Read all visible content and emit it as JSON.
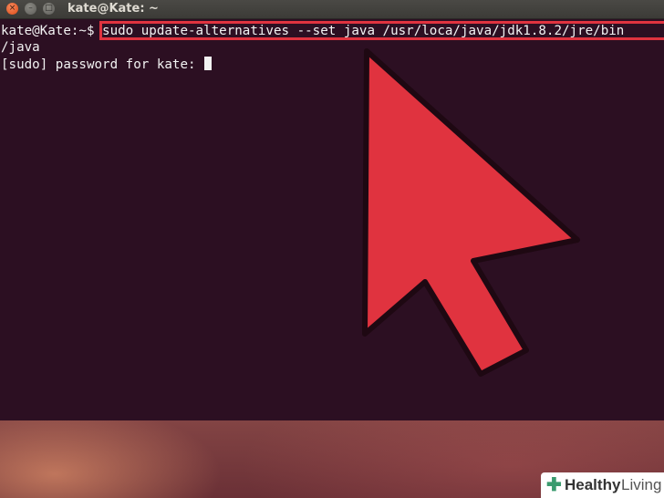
{
  "window": {
    "title": "kate@Kate: ~",
    "close_glyph": "×",
    "minimize_glyph": "–",
    "maximize_glyph": "□"
  },
  "terminal": {
    "prompt": "kate@Kate:~$ ",
    "command": "sudo update-alternatives --set java /usr/loca/java/jdk1.8.2/jre/bin",
    "command_wrap": "/java",
    "sudo_prompt": "[sudo] password for kate: "
  },
  "annotation": {
    "highlight_color": "#e0333f",
    "arrow_color": "#e0333f",
    "arrow_icon": "arrow-pointer-icon"
  },
  "watermark": {
    "icon": "plus-icon",
    "brand": "Healthy",
    "sub": "Living",
    "accent": "#3a9b6e"
  }
}
